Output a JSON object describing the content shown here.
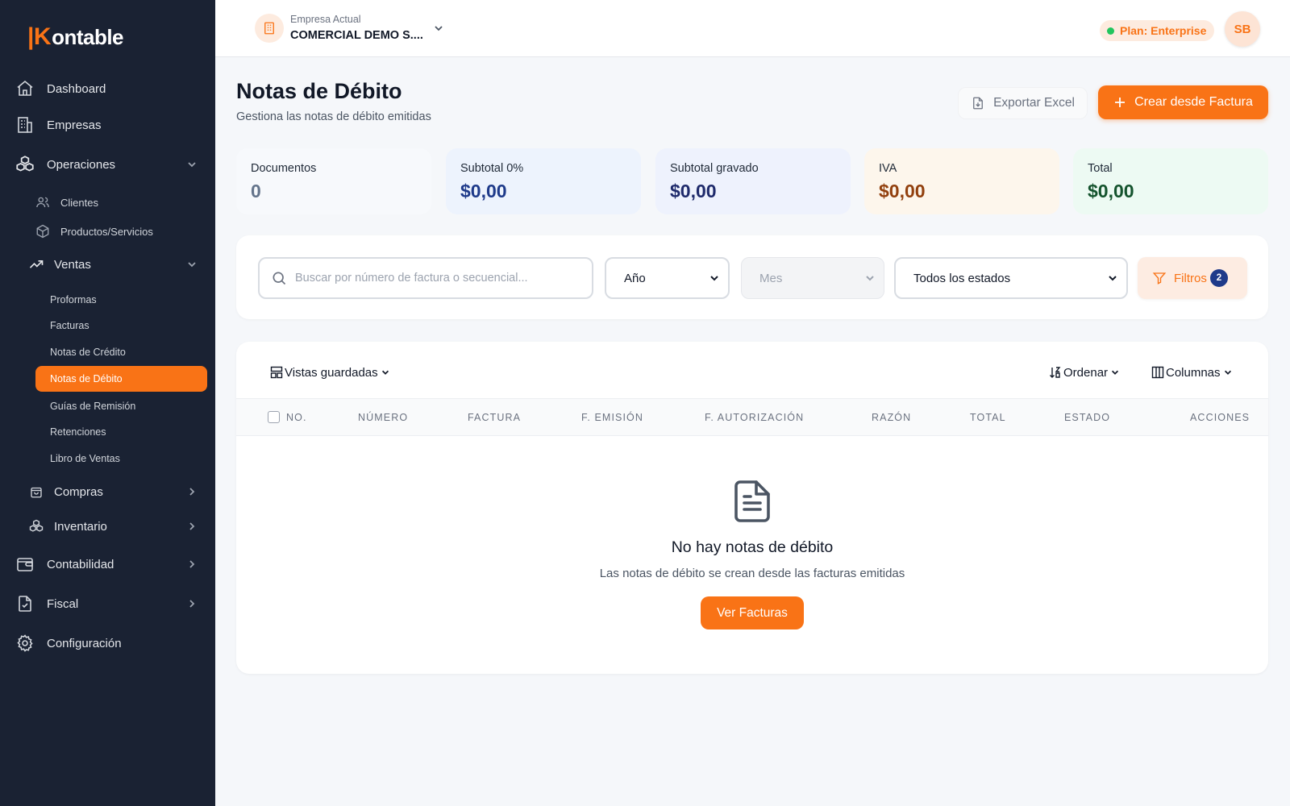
{
  "app": {
    "logo_mark": "|K",
    "logo_text": "ontable"
  },
  "sidebar": {
    "dashboard": "Dashboard",
    "empresas": "Empresas",
    "operaciones": "Operaciones",
    "clientes": "Clientes",
    "productos": "Productos/Servicios",
    "ventas": "Ventas",
    "proformas": "Proformas",
    "facturas": "Facturas",
    "notas_credito": "Notas de Crédito",
    "notas_debito": "Notas de Débito",
    "guias": "Guías de Remisión",
    "retenciones": "Retenciones",
    "libro_ventas": "Libro de Ventas",
    "compras": "Compras",
    "inventario": "Inventario",
    "contabilidad": "Contabilidad",
    "fiscal": "Fiscal",
    "configuracion": "Configuración"
  },
  "topbar": {
    "company_label": "Empresa Actual",
    "company_name": "COMERCIAL DEMO S....",
    "plan": "Plan: Enterprise",
    "avatar_initials": "SB"
  },
  "header": {
    "title": "Notas de Débito",
    "subtitle": "Gestiona las notas de débito emitidas",
    "export_label": "Exportar Excel",
    "create_label": "Crear desde Factura"
  },
  "stats": {
    "documentos": {
      "label": "Documentos",
      "value": "0"
    },
    "subtotal0": {
      "label": "Subtotal 0%",
      "value": "$0,00"
    },
    "gravado": {
      "label": "Subtotal gravado",
      "value": "$0,00"
    },
    "iva": {
      "label": "IVA",
      "value": "$0,00"
    },
    "total": {
      "label": "Total",
      "value": "$0,00"
    }
  },
  "filters": {
    "search_placeholder": "Buscar por número de factura o secuencial...",
    "year": "Año",
    "month": "Mes",
    "status": "Todos los estados",
    "filters_label": "Filtros",
    "filters_count": "2"
  },
  "table": {
    "saved_views": "Vistas guardadas",
    "sort": "Ordenar",
    "columns": "Columnas",
    "headers": [
      "NO.",
      "NÚMERO",
      "FACTURA",
      "F. EMISIÓN",
      "F. AUTORIZACIÓN",
      "RAZÓN",
      "TOTAL",
      "ESTADO",
      "ACCIONES"
    ]
  },
  "empty": {
    "title": "No hay notas de débito",
    "subtitle": "Las notas de débito se crean desde las facturas emitidas",
    "button": "Ver Facturas"
  },
  "colors": {
    "accent": "#f97316",
    "sidebar_bg": "#1a2233",
    "plan_dot": "#22c55e",
    "badge_count": "#1e3a8a"
  }
}
